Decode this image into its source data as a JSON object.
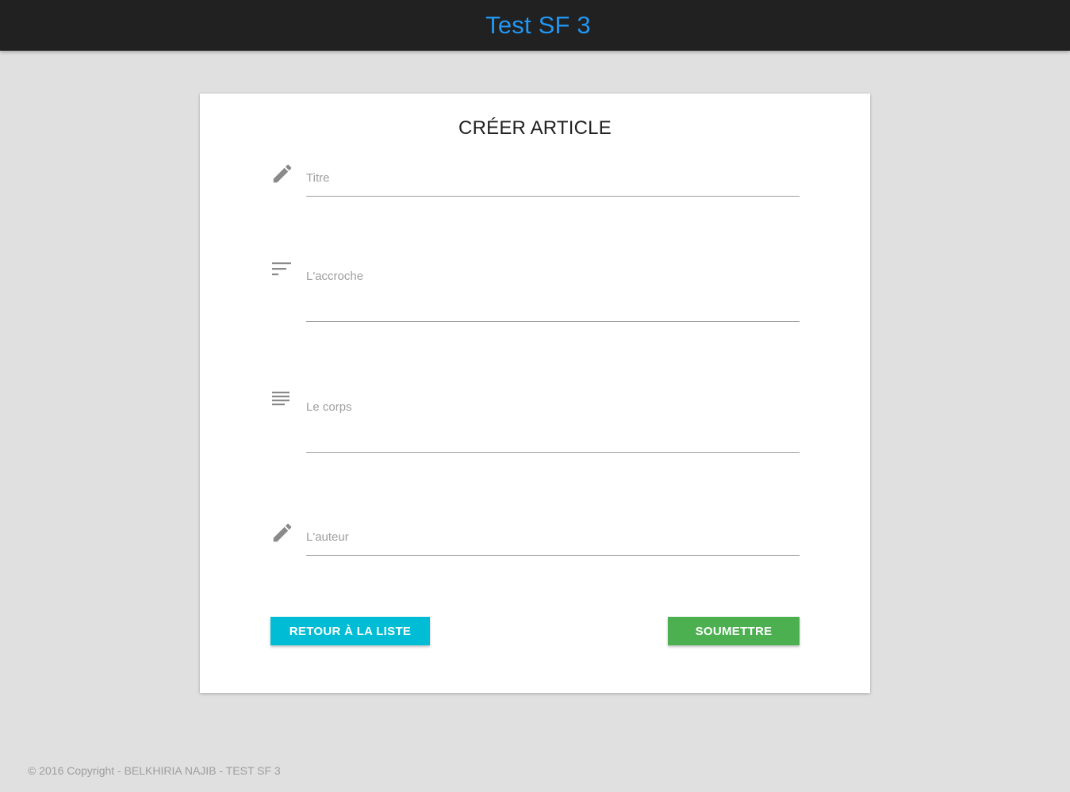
{
  "header": {
    "brand": "Test SF 3",
    "brand_color": "#2196f3",
    "background": "#212121"
  },
  "form": {
    "title": "CRÉER ARTICLE",
    "fields": [
      {
        "label": "Titre",
        "icon": "pencil-icon",
        "value": ""
      },
      {
        "label": "L'accroche",
        "icon": "short-text-icon",
        "value": ""
      },
      {
        "label": "Le corps",
        "icon": "subject-icon",
        "value": ""
      },
      {
        "label": "L'auteur",
        "icon": "pencil-icon",
        "value": ""
      }
    ],
    "buttons": {
      "back_label": "RETOUR À LA LISTE",
      "back_color": "#00bcd4",
      "submit_label": "SOUMETTRE",
      "submit_color": "#4caf50"
    }
  },
  "footer": {
    "text": "© 2016 Copyright - BELKHIRIA NAJIB - TEST SF 3"
  }
}
